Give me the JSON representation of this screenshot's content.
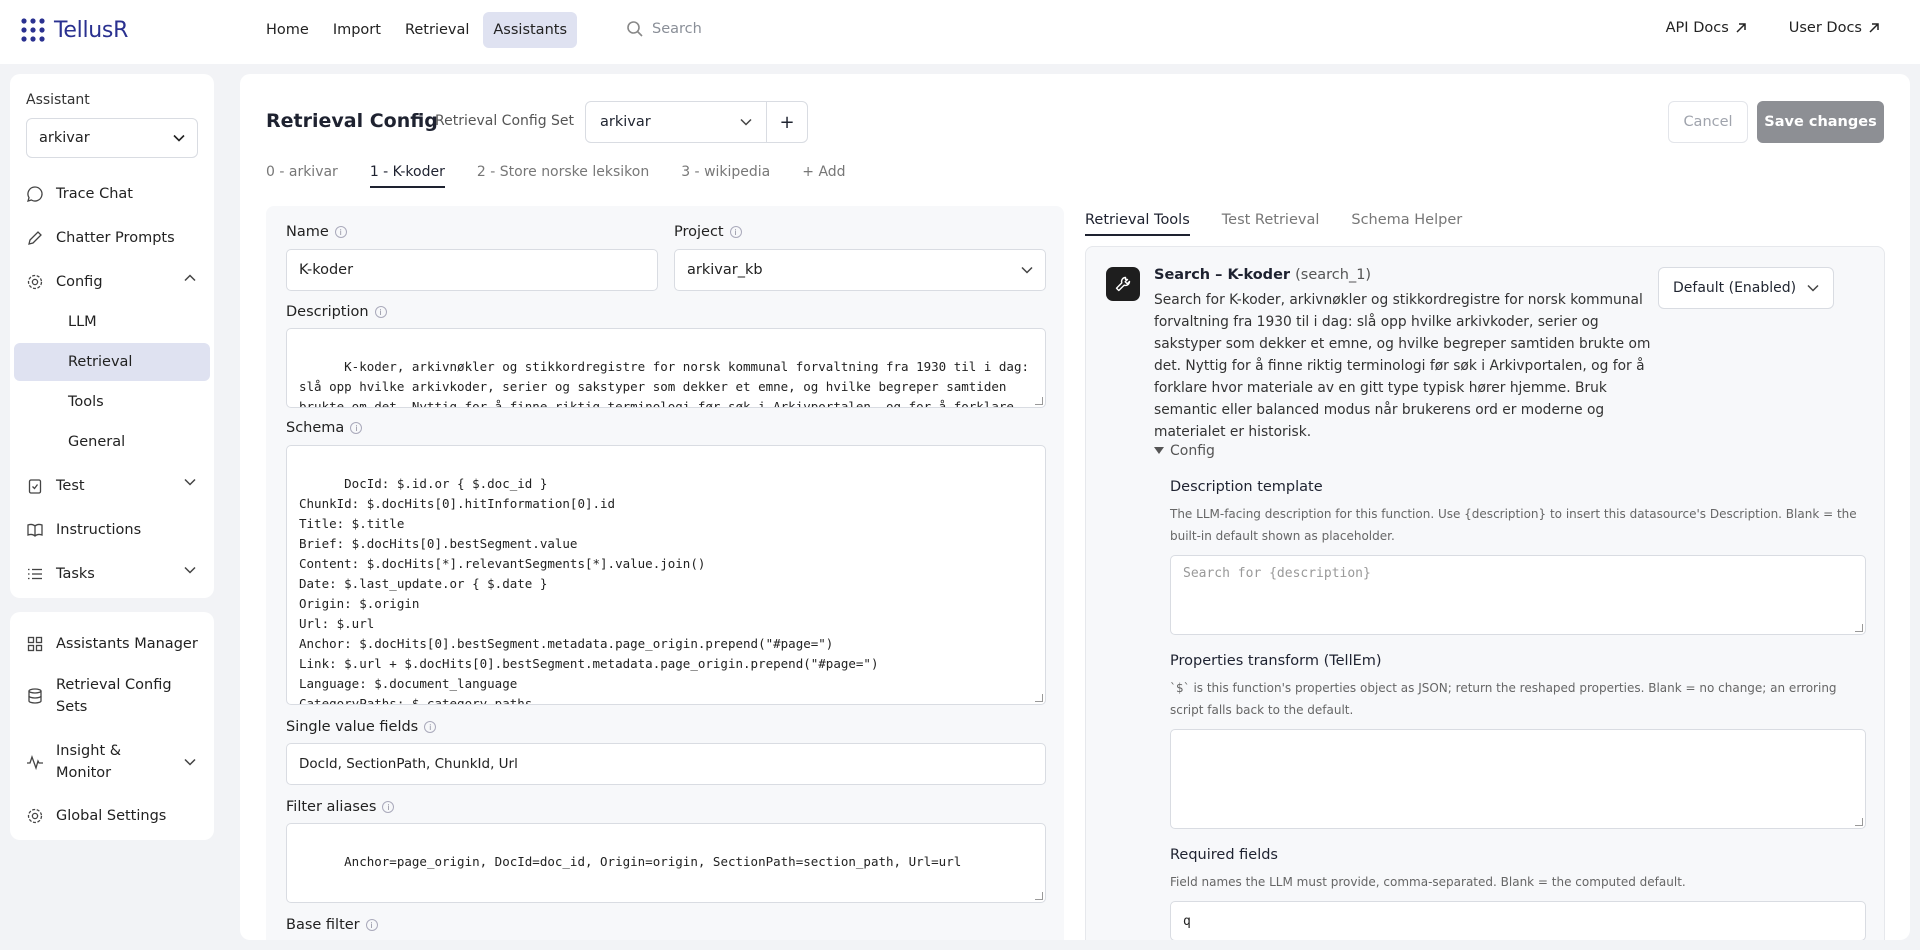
{
  "app": {
    "name": "TellusR"
  },
  "nav": {
    "items": [
      "Home",
      "Import",
      "Retrieval",
      "Assistants"
    ],
    "active": "Assistants",
    "search_placeholder": "Search",
    "api_docs": "API Docs",
    "user_docs": "User Docs"
  },
  "sidebar": {
    "assistant_label": "Assistant",
    "assistant_value": "arkivar",
    "items": {
      "trace_chat": "Trace Chat",
      "chatter_prompts": "Chatter Prompts",
      "config": "Config",
      "llm": "LLM",
      "retrieval": "Retrieval",
      "tools": "Tools",
      "general": "General",
      "test": "Test",
      "instructions": "Instructions",
      "tasks": "Tasks"
    },
    "bottom": {
      "assistants_manager": "Assistants Manager",
      "retrieval_config_sets": "Retrieval Config Sets",
      "insight_monitor": "Insight & Monitor",
      "global_settings": "Global Settings"
    }
  },
  "header": {
    "title": "Retrieval Config",
    "config_set_label": "Retrieval Config Set",
    "config_set_value": "arkivar",
    "add": "+",
    "cancel": "Cancel",
    "save": "Save changes"
  },
  "tabs": [
    "0 - arkivar",
    "1 - K-koder",
    "2 - Store norske leksikon",
    "3 - wikipedia",
    "+ Add"
  ],
  "active_tab": "1 - K-koder",
  "form": {
    "name_label": "Name",
    "name_value": "K-koder",
    "project_label": "Project",
    "project_value": "arkivar_kb",
    "description_label": "Description",
    "description_value": "K-koder, arkivnøkler og stikkordregistre for norsk kommunal forvaltning fra 1930 til i dag: slå opp hvilke arkivkoder, serier og sakstyper som dekker et emne, og hvilke begreper samtiden brukte om det. Nyttig for å finne riktig terminologi før søk i Arkivportalen, og for å forklare hvor materiale av en gitt type typisk hører hjemme. Bruk semantic eller balanced",
    "schema_label": "Schema",
    "schema_value": "DocId: $.id.or { $.doc_id }\nChunkId: $.docHits[0].hitInformation[0].id\nTitle: $.title\nBrief: $.docHits[0].bestSegment.value\nContent: $.docHits[*].relevantSegments[*].value.join()\nDate: $.last_update.or { $.date }\nOrigin: $.origin\nUrl: $.url\nAnchor: $.docHits[0].bestSegment.metadata.page_origin.prepend(\"#page=\")\nLink: $.url + $.docHits[0].bestSegment.metadata.page_origin.prepend(\"#page=\")\nLanguage: $.document_language\nCategoryPaths: $.category_paths\nSectionPath:",
    "single_value_label": "Single value fields",
    "single_value_value": "DocId, SectionPath, ChunkId, Url",
    "filter_aliases_label": "Filter aliases",
    "filter_aliases_value": "Anchor=page_origin, DocId=doc_id, Origin=origin, SectionPath=section_path, Url=url",
    "base_filter_label": "Base filter"
  },
  "right": {
    "tabs": [
      "Retrieval Tools",
      "Test Retrieval",
      "Schema Helper"
    ],
    "active_tab": "Retrieval Tools",
    "tool_name": "Search – K-koder",
    "tool_id": "(search_1)",
    "tool_description": "Search for K-koder, arkivnøkler og stikkordregistre for norsk kommunal forvaltning fra 1930 til i dag: slå opp hvilke arkivkoder, serier og sakstyper som dekker et emne, og hvilke begreper samtiden brukte om det. Nyttig for å finne riktig terminologi før søk i Arkivportalen, og for å forklare hvor materiale av en gitt type typisk hører hjemme. Bruk semantic eller balanced modus når brukerens ord er moderne og materialet er historisk.",
    "tool_mode": "Default (Enabled)",
    "config_toggle": "Config",
    "desc_template_label": "Description template",
    "desc_template_hint": "The LLM-facing description for this function. Use {description} to insert this datasource's Description. Blank = the built-in default shown as placeholder.",
    "desc_template_placeholder": "Search for {description}",
    "props_label": "Properties transform (TellEm)",
    "props_hint": "`$` is this function's properties object as JSON; return the reshaped properties. Blank = no change; an erroring script falls back to the default.",
    "required_label": "Required fields",
    "required_hint": "Field names the LLM must provide, comma-separated. Blank = the computed default.",
    "required_value": "q"
  }
}
